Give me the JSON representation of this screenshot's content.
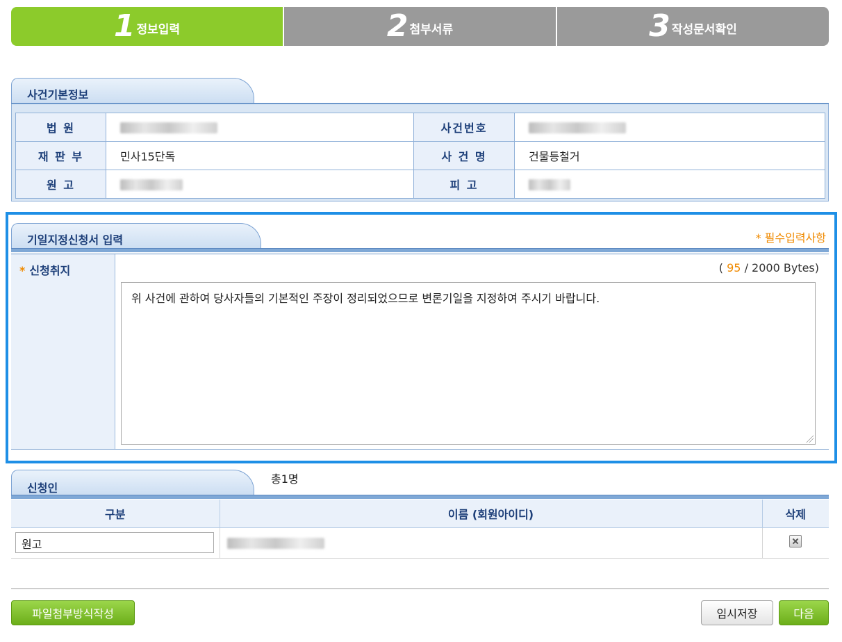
{
  "steps": [
    {
      "num": "1",
      "label": "정보입력"
    },
    {
      "num": "2",
      "label": "첨부서류"
    },
    {
      "num": "3",
      "label": "작성문서확인"
    }
  ],
  "case_info": {
    "title": "사건기본정보",
    "labels": {
      "court": "법 원",
      "case_number": "사건번호",
      "division": "재 판 부",
      "case_name": "사 건 명",
      "plaintiff": "원 고",
      "defendant": "피 고"
    },
    "division_value": "민사15단독",
    "case_name_value": "건물등철거"
  },
  "application": {
    "title": "기일지정신청서 입력",
    "required_note": "* 필수입력사항",
    "purpose_label": "신청취지",
    "required_star": "*",
    "byte_count": "95",
    "byte_limit": "/ 2000 Bytes)",
    "byte_open": "(",
    "purpose_text": "위 사건에 관하여 당사자들의 기본적인 주장이 정리되었으므로 변론기일을 지정하여 주시기 바랍니다."
  },
  "applicants": {
    "title": "신청인",
    "total": "총1명",
    "columns": [
      "구분",
      "이름 (회원아이디)",
      "삭제"
    ],
    "rows": [
      {
        "type": "원고"
      }
    ]
  },
  "buttons": {
    "file_attach": "파일첨부방식작성",
    "temp_save": "임시저장",
    "next": "다음"
  },
  "colors": {
    "step_active": "#8ccb2b",
    "step_inactive": "#9a9a9a",
    "highlight_border": "#1e8fe6",
    "required_orange": "#f08a00"
  }
}
